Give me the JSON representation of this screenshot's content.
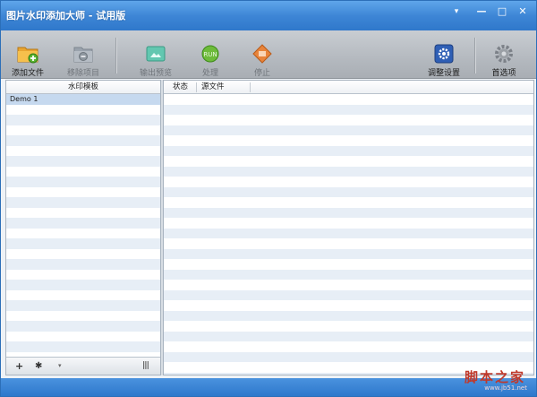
{
  "window": {
    "title": "图片水印添加大师 - 试用版",
    "controls": {
      "menu": "▾",
      "minimize": "—",
      "maximize": "□",
      "close": "✕"
    }
  },
  "toolbar": {
    "add_file": "添加文件",
    "remove_item": "移除项目",
    "output_preview": "输出预览",
    "process": "处理",
    "stop": "停止",
    "adjust_settings": "调整设置",
    "preferences": "首选项"
  },
  "left_panel": {
    "header": "水印模板",
    "items": [
      {
        "label": "Demo 1",
        "selected": true
      }
    ],
    "bottom_buttons": {
      "add": "+",
      "settings": "✱",
      "dropdown": "▾",
      "columns": "|||"
    }
  },
  "right_panel": {
    "columns": [
      "状态",
      "源文件"
    ]
  },
  "footer": {
    "watermark": "脚本之家",
    "watermark_url": "www.jb51.net"
  },
  "colors": {
    "title_bar": "#3e86d6",
    "selected_row": "#c6d9ef",
    "stripe_row": "#e7eef6",
    "watermark": "#c0392b"
  }
}
